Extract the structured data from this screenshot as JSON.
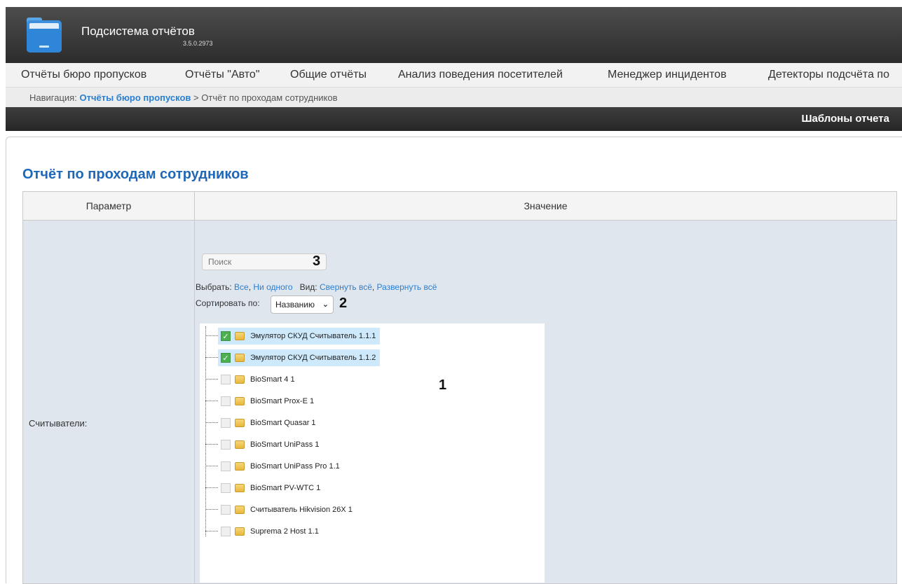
{
  "header": {
    "title": "Подсистема отчётов",
    "version": "3.5.0.2973"
  },
  "menu": {
    "items": [
      "Отчёты бюро пропусков",
      "Отчёты \"Авто\"",
      "Общие отчёты",
      "Анализ поведения посетителей",
      "Менеджер инцидентов",
      "Детекторы подсчёта по"
    ]
  },
  "breadcrumb": {
    "prefix": "Навигация:",
    "link": "Отчёты бюро пропусков",
    "separator": ">",
    "current": "Отчёт по проходам сотрудников"
  },
  "toolbar": {
    "templates": "Шаблоны отчета"
  },
  "page": {
    "title": "Отчёт по проходам сотрудников"
  },
  "table": {
    "col_param": "Параметр",
    "col_value": "Значение",
    "row_label": "Считыватели:"
  },
  "filter": {
    "search_placeholder": "Поиск",
    "select_label": "Выбрать:",
    "select_all": "Все",
    "select_none": "Ни одного",
    "view_label": "Вид:",
    "collapse_all": "Свернуть всё",
    "expand_all": "Развернуть всё",
    "sort_label": "Сортировать по:",
    "sort_value": "Названию"
  },
  "annotations": {
    "tree": "1",
    "sort": "2",
    "search": "3"
  },
  "readers": [
    {
      "label": "Эмулятор СКУД Считыватель 1.1.1",
      "checked": true
    },
    {
      "label": "Эмулятор СКУД Считыватель 1.1.2",
      "checked": true
    },
    {
      "label": "BioSmart 4 1",
      "checked": false
    },
    {
      "label": "BioSmart Prox-E 1",
      "checked": false
    },
    {
      "label": "BioSmart Quasar 1",
      "checked": false
    },
    {
      "label": "BioSmart UniPass 1",
      "checked": false
    },
    {
      "label": "BioSmart UniPass Pro 1.1",
      "checked": false
    },
    {
      "label": "BioSmart PV-WTC 1",
      "checked": false
    },
    {
      "label": "Считыватель Hikvision 26X 1",
      "checked": false
    },
    {
      "label": "Suprema 2 Host 1.1",
      "checked": false
    }
  ]
}
